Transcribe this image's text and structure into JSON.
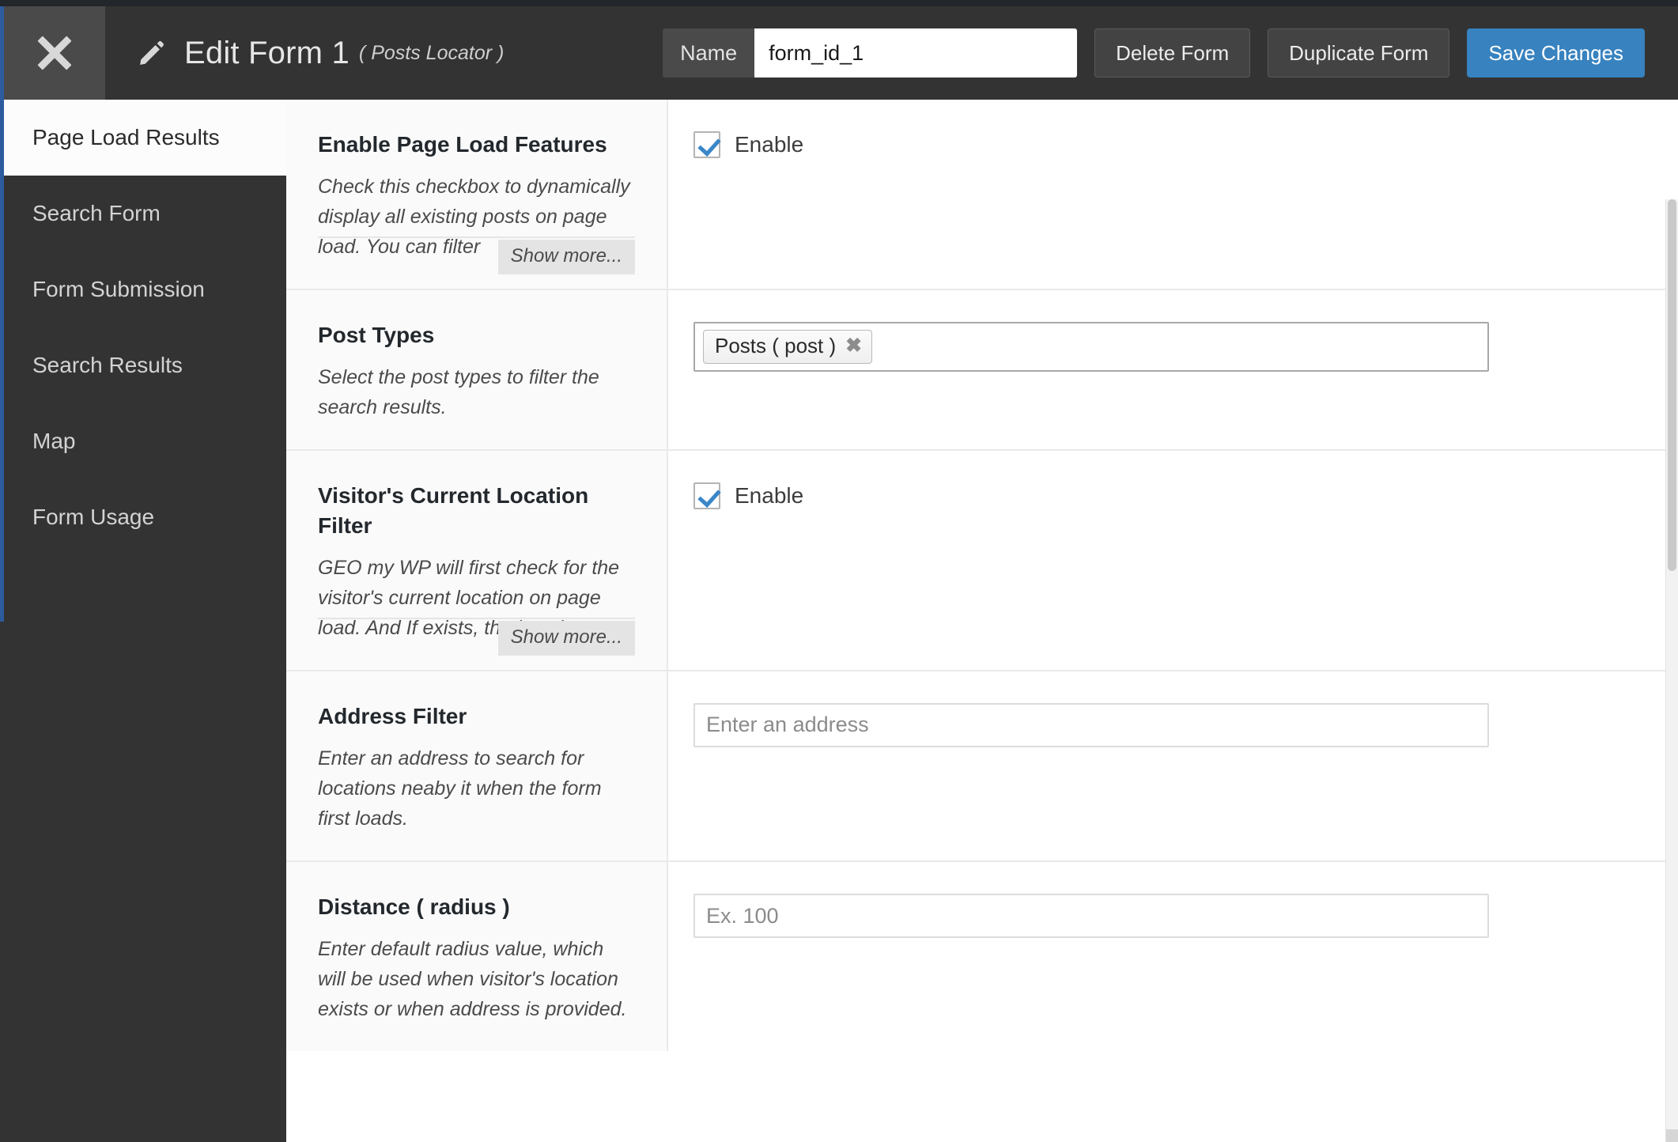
{
  "header": {
    "close_icon": "close-icon",
    "pencil_icon": "pencil-icon",
    "title": "Edit Form 1",
    "subtitle": "( Posts Locator )",
    "name_label": "Name",
    "name_value": "form_id_1",
    "name_placeholder": "",
    "delete_label": "Delete Form",
    "duplicate_label": "Duplicate Form",
    "save_label": "Save Changes",
    "accent_color": "#3782bf",
    "bar_color": "#333333"
  },
  "sidebar": {
    "accent_color": "#2e5b9e",
    "items": [
      {
        "label": "Page Load Results",
        "active": true
      },
      {
        "label": "Search Form",
        "active": false
      },
      {
        "label": "Form Submission",
        "active": false
      },
      {
        "label": "Search Results",
        "active": false
      },
      {
        "label": "Map",
        "active": false
      },
      {
        "label": "Form Usage",
        "active": false
      }
    ]
  },
  "settings": {
    "show_more_label": "Show more...",
    "rows": [
      {
        "title": "Enable Page Load Features",
        "description": "Check this checkbox to dynamically display all existing posts on page load. You can filter",
        "has_show_more": true,
        "control": "checkbox",
        "checkbox_label": "Enable",
        "checked": true
      },
      {
        "title": "Post Types",
        "description": "Select the post types to filter the search results.",
        "has_show_more": false,
        "control": "tokens",
        "tokens": [
          {
            "label": "Posts ( post )",
            "remove_icon": "close-icon"
          }
        ]
      },
      {
        "title": "Visitor's Current Location Filter",
        "description": "GEO my WP will first check for the visitor's current location on page load. And If exists, the locations",
        "has_show_more": true,
        "control": "checkbox",
        "checkbox_label": "Enable",
        "checked": true
      },
      {
        "title": "Address Filter",
        "description": "Enter an address to search for locations neaby it when the form first loads.",
        "has_show_more": false,
        "control": "text",
        "value": "",
        "placeholder": "Enter an address"
      },
      {
        "title": "Distance ( radius )",
        "description": "Enter default radius value, which will be used when visitor's location exists or when address is provided.",
        "has_show_more": false,
        "control": "text",
        "value": "",
        "placeholder": "Ex. 100"
      }
    ]
  }
}
